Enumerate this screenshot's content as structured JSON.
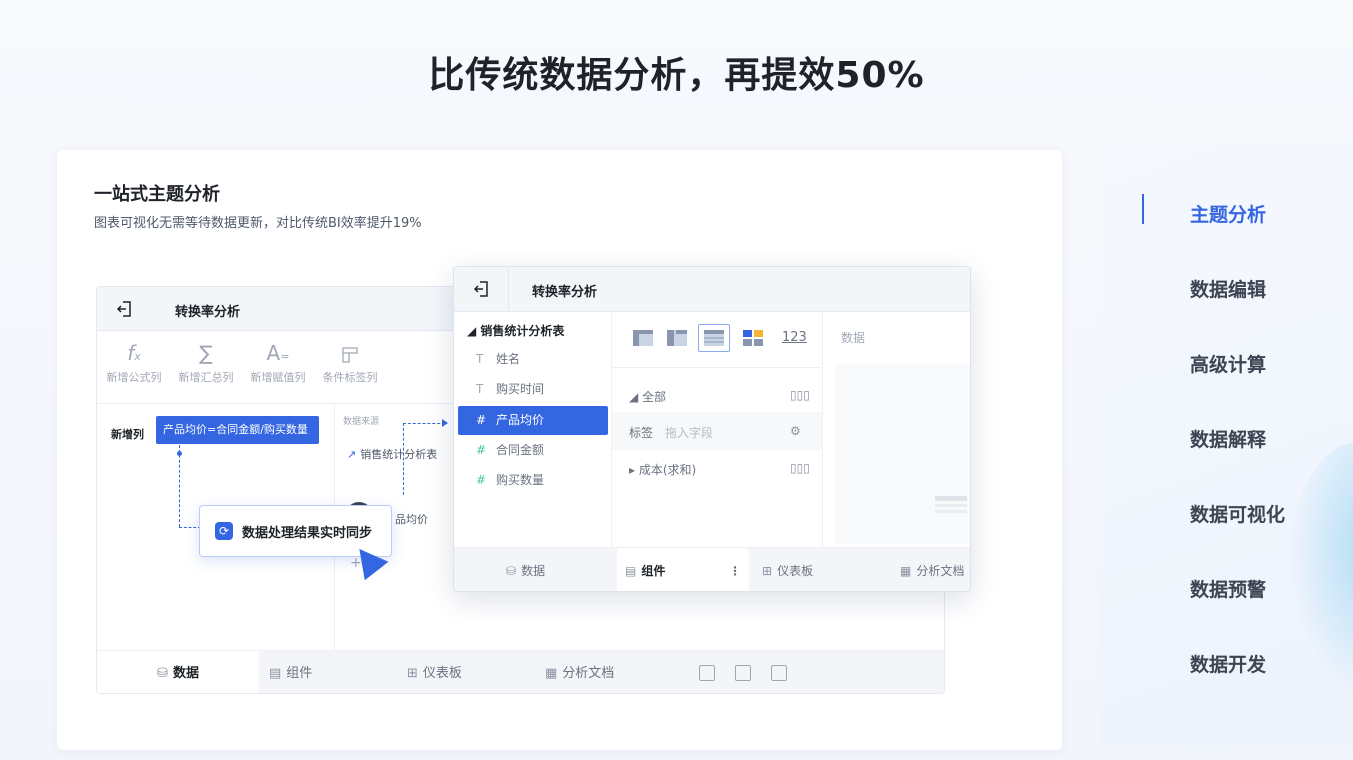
{
  "hero": {
    "title": "比传统数据分析，再提效50%"
  },
  "card": {
    "title": "一站式主题分析",
    "subtitle": "图表可视化无需等待数据更新，对比传统BI效率提升19%"
  },
  "back_window": {
    "title": "转换率分析",
    "tools": [
      {
        "icon": "fx-icon",
        "label": "新增公式列"
      },
      {
        "icon": "sigma-icon",
        "label": "新增汇总列"
      },
      {
        "icon": "text-assign-icon",
        "label": "新增赋值列"
      },
      {
        "icon": "tag-column-icon",
        "label": "条件标签列"
      }
    ],
    "new_column_label": "新增列",
    "formula": "产品均价=合同金额/购买数量",
    "data_source_label": "数据来源",
    "source_table": "销售统计分析表",
    "field_stub": "品均价",
    "sync_popup": "数据处理结果实时同步",
    "tabs": [
      {
        "label": "数据",
        "icon": "database-icon",
        "active": true
      },
      {
        "label": "组件",
        "icon": "component-icon",
        "active": false
      },
      {
        "label": "仪表板",
        "icon": "dashboard-icon",
        "active": false
      },
      {
        "label": "分析文档",
        "icon": "document-icon",
        "active": false
      }
    ]
  },
  "front_window": {
    "title": "转换率分析",
    "table_name": "销售统计分析表",
    "fields": [
      {
        "type": "T",
        "name": "姓名",
        "selected": false
      },
      {
        "type": "T",
        "name": "购买时间",
        "selected": false
      },
      {
        "type": "#",
        "name": "产品均价",
        "selected": true
      },
      {
        "type": "#",
        "name": "合同金额",
        "selected": false
      },
      {
        "type": "#",
        "name": "购买数量",
        "selected": false
      }
    ],
    "chart_type_number": "123",
    "config": {
      "all_label": "全部",
      "tag_label": "标签",
      "tag_placeholder": "拖入字段",
      "measure": "成本(求和)"
    },
    "data_label": "数据",
    "tabs": [
      {
        "label": "数据",
        "icon": "database-icon",
        "active": false
      },
      {
        "label": "组件",
        "icon": "component-icon",
        "active": true
      },
      {
        "label": "仪表板",
        "icon": "dashboard-icon",
        "active": false
      },
      {
        "label": "分析文档",
        "icon": "document-icon",
        "active": false
      }
    ],
    "more_glyph": "⋮"
  },
  "side_nav": {
    "items": [
      {
        "label": "主题分析",
        "active": true
      },
      {
        "label": "数据编辑",
        "active": false
      },
      {
        "label": "高级计算",
        "active": false
      },
      {
        "label": "数据解释",
        "active": false
      },
      {
        "label": "数据可视化",
        "active": false
      },
      {
        "label": "数据预警",
        "active": false
      },
      {
        "label": "数据开发",
        "active": false
      }
    ]
  },
  "colors": {
    "accent": "#3366e0",
    "text": "#1f2329",
    "muted": "#a0a7b4",
    "numeric_field": "#4cc4a8"
  }
}
